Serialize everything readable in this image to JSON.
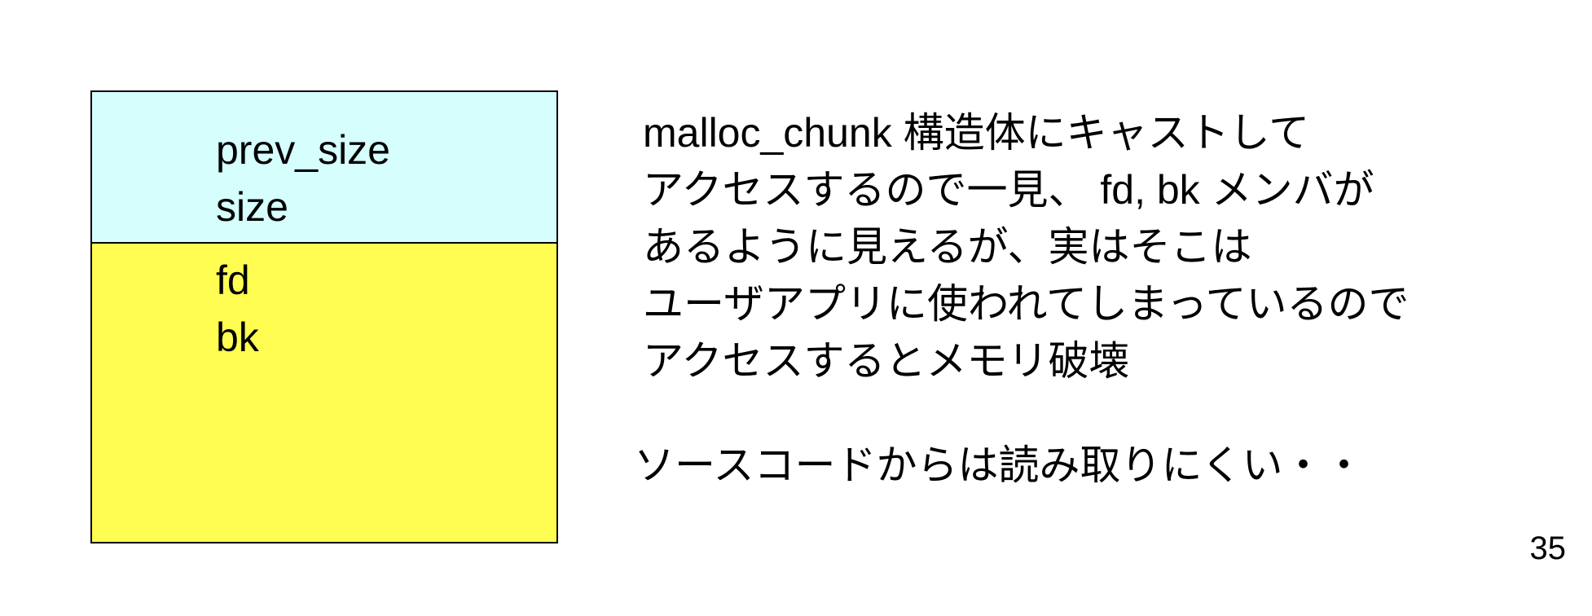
{
  "colors": {
    "header_fill": "#d5fefd",
    "body_fill": "#fffd51",
    "border": "#000000"
  },
  "chunk": {
    "header_fields": [
      "prev_size",
      "size"
    ],
    "body_fields": [
      "fd",
      "bk"
    ]
  },
  "explanation": {
    "lines": [
      "malloc_chunk 構造体にキャストして",
      "アクセスするので一見、 fd, bk メンバが",
      "あるように見えるが、実はそこは",
      "ユーザアプリに使われてしまっているので",
      "アクセスするとメモリ破壊"
    ],
    "note": "ソースコードからは読み取りにくい・・"
  },
  "page_number": "35"
}
